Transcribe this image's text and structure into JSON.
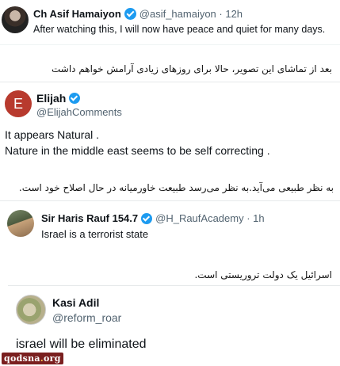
{
  "tweets": [
    {
      "name": "Ch Asif Hamaiyon",
      "handle": "@asif_hamaiyon · 12h",
      "text": "After watching this, I will now have peace and quiet for many days.",
      "translation": "بعد از تماشای این تصویر، حالا برای روزهای زیادی آرامش خواهم داشت"
    },
    {
      "name": "Elijah",
      "avatar_letter": "E",
      "handle": "@ElijahComments",
      "text_line1": "It appears Natural .",
      "text_line2": "Nature in the middle east seems to be self correcting .",
      "translation": "به نظر طبیعی می‌آید.به نظر می‌رسد طبیعت خاورمیانه در حال اصلاح خود است."
    },
    {
      "name": "Sir Haris Rauf 154.7",
      "handle": "@H_RaufAcademy · 1h",
      "text": "Israel is a terrorist state",
      "translation": "اسرائیل یک دولت تروریستی است."
    },
    {
      "name": "Kasi Adil",
      "handle": "@reform_roar",
      "text": "israel will be eliminated"
    }
  ],
  "watermark": {
    "prefix": "qodsna",
    "dot": ".",
    "suffix": "org"
  },
  "colors": {
    "verified": "#1d9bf0",
    "handle": "#536471",
    "text": "#0f1419"
  },
  "icons": [
    "verified-badge-icon"
  ]
}
